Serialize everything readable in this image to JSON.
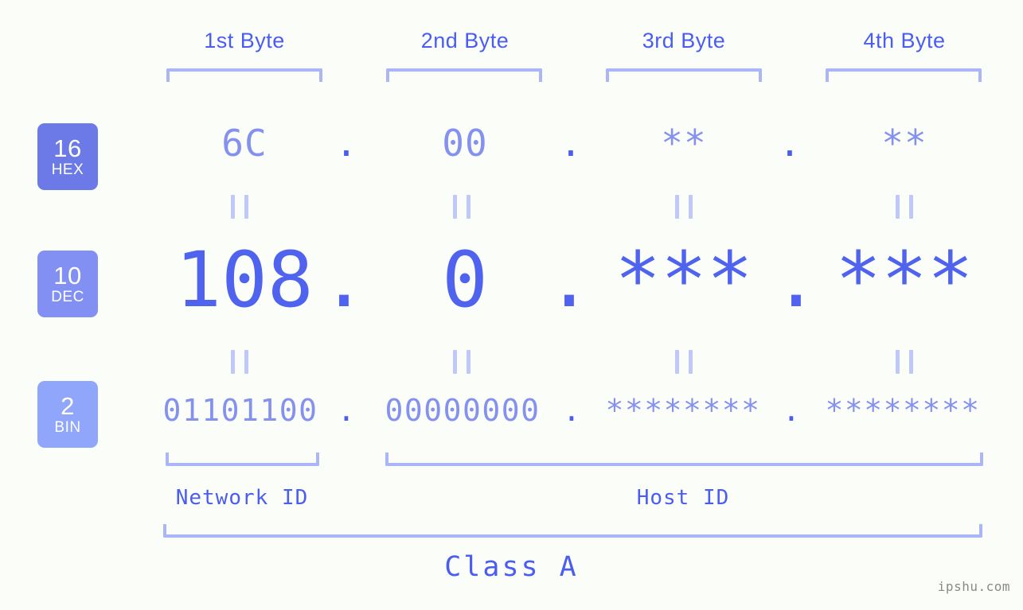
{
  "meta": {
    "background_color": "#fbfdf8",
    "accent_color": "#4a5df0",
    "light_accent_color": "#8591ee",
    "bracket_color": "#abb6f9",
    "connector_color": "#c0c8fa"
  },
  "byte_headers": [
    {
      "label": "1st Byte"
    },
    {
      "label": "2nd Byte"
    },
    {
      "label": "3rd Byte"
    },
    {
      "label": "4th Byte"
    }
  ],
  "radix_badges": [
    {
      "number": "16",
      "abbr": "HEX",
      "color": "#6b7ae6"
    },
    {
      "number": "10",
      "abbr": "DEC",
      "color": "#8190f2"
    },
    {
      "number": "2",
      "abbr": "BIN",
      "color": "#8fa6fa"
    }
  ],
  "rows": {
    "hex": {
      "values": [
        "6C",
        "00",
        "**",
        "**"
      ],
      "separator": "."
    },
    "dec": {
      "values": [
        "108",
        "0",
        "***",
        "***"
      ],
      "separator": "."
    },
    "bin": {
      "values": [
        "01101100",
        "00000000",
        "********",
        "********"
      ],
      "separator": "."
    }
  },
  "connector_symbol": "||",
  "segments": [
    {
      "label": "Network ID"
    },
    {
      "label": "Host ID"
    }
  ],
  "class": {
    "label": "Class A"
  },
  "watermark": {
    "text": "ipshu.com"
  }
}
